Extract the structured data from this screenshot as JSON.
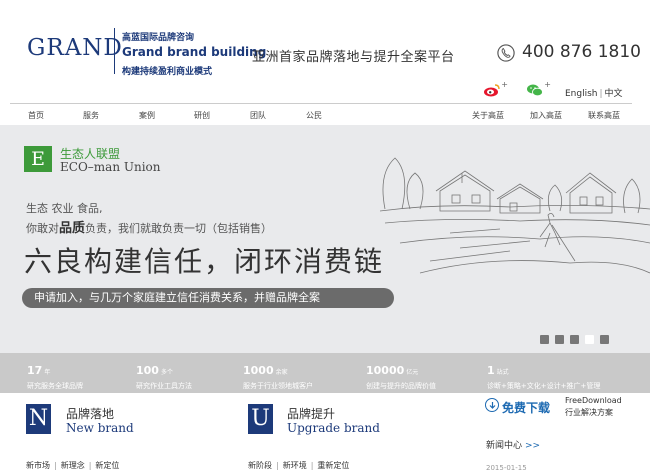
{
  "logo": {
    "word": "GRAND",
    "cn_line1": "高蓝国际品牌咨询",
    "en_line": "Grand brand building",
    "cn_line2": "构建持续盈利商业模式"
  },
  "header": {
    "slogan": "亚洲首家品牌落地与提升全案平台",
    "phone": "400 876 1810",
    "phone_icon": "phone-icon",
    "social": [
      {
        "name": "weibo-icon",
        "color": "#e6162d"
      },
      {
        "name": "wechat-icon",
        "color": "#44b549"
      }
    ],
    "lang_en": "English",
    "lang_cn": "中文"
  },
  "nav": {
    "items": [
      "首页",
      "服务",
      "案例",
      "研创",
      "团队",
      "公民"
    ],
    "right_items": [
      "关于高蓝",
      "加入高蓝",
      "联系高蓝"
    ]
  },
  "hero": {
    "badge_letter": "E",
    "badge_cn": "生态人联盟",
    "badge_en": "ECO–man Union",
    "sub1": "生态 农业 食品,",
    "sub2_a": "你敢对",
    "sub2_b": "品质",
    "sub2_c": "负责，我们就敢负责一切（包括销售）",
    "headline": "六良构建信任，闭环消费链",
    "cta": "申请加入，与几万个家庭建立信任消费关系，并赠品牌全案",
    "slide_count": 5,
    "active_slide": 4,
    "accent": "#3d9a3a"
  },
  "stats": [
    {
      "num": "17",
      "unit": "年",
      "desc": "研究服务全球品牌"
    },
    {
      "num": "100",
      "unit": "多个",
      "desc": "研究作业工具方法"
    },
    {
      "num": "1000",
      "unit": "余家",
      "desc": "服务于行业领地城客户"
    },
    {
      "num": "10000",
      "unit": "亿元",
      "desc": "创建与提升的品牌价值"
    },
    {
      "num": "1",
      "unit": "站式",
      "desc": "诊断+策略+文化+设计+推广+管理"
    }
  ],
  "sections": {
    "new": {
      "letter": "N",
      "cn": "品牌落地",
      "en": "New brand",
      "links": [
        "新市场",
        "新理念",
        "新定位"
      ]
    },
    "upgrade": {
      "letter": "U",
      "cn": "品牌提升",
      "en": "Upgrade brand",
      "links": [
        "新阶段",
        "新环境",
        "重新定位"
      ]
    }
  },
  "download": {
    "label": "免费下载",
    "line1": "FreeDownload",
    "line2": "行业解决方案"
  },
  "news": {
    "title": "新闻中心",
    "more": ">>",
    "date": "2015-01-15"
  },
  "brand_color": "#1d3a7a"
}
